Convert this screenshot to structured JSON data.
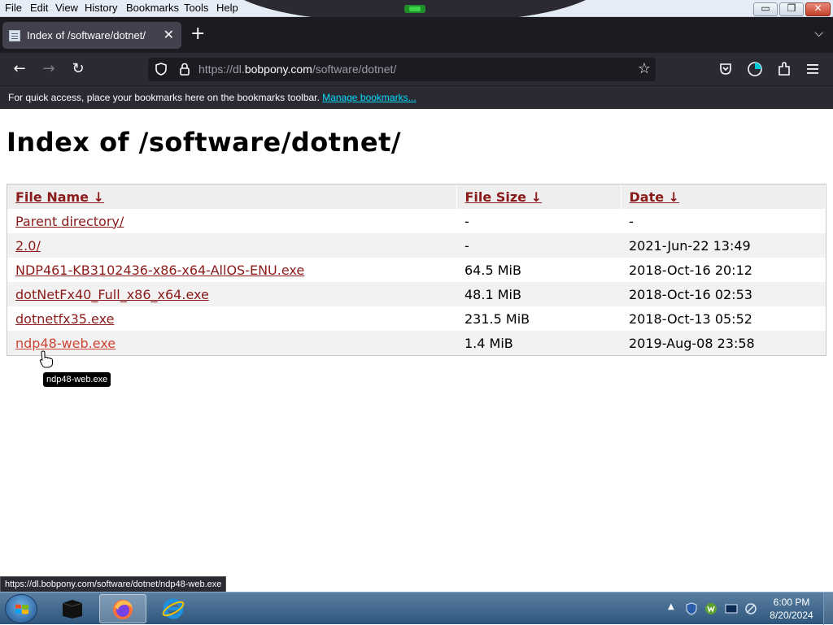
{
  "menubar": {
    "items": [
      "File",
      "Edit",
      "View",
      "History",
      "Bookmarks",
      "Tools",
      "Help"
    ],
    "window_buttons": {
      "minimize": "▭",
      "restore": "❐",
      "close": "✕"
    }
  },
  "tab": {
    "title": "Index of /software/dotnet/",
    "close_icon": "✕",
    "new_tab_icon": "+",
    "list_tabs_icon": "⌵"
  },
  "navbar": {
    "back_icon": "←",
    "forward_icon": "→",
    "reload_icon": "↻",
    "url_prefix": "https://dl.",
    "url_host": "bobpony.com",
    "url_path": "/software/dotnet/",
    "bookmark_star_icon": "☆"
  },
  "bookmarks_bar": {
    "message": "For quick access, place your bookmarks here on the bookmarks toolbar.",
    "manage_link": "Manage bookmarks..."
  },
  "page": {
    "title": "Index of /software/dotnet/",
    "columns": [
      "File Name  ↓",
      "File Size  ↓",
      "Date  ↓"
    ],
    "rows": [
      {
        "name": "Parent directory/",
        "size": "-",
        "date": "-"
      },
      {
        "name": "2.0/",
        "size": "-",
        "date": "2021-Jun-22 13:49"
      },
      {
        "name": "NDP461-KB3102436-x86-x64-AllOS-ENU.exe",
        "size": "64.5 MiB",
        "date": "2018-Oct-16 20:12"
      },
      {
        "name": "dotNetFx40_Full_x86_x64.exe",
        "size": "48.1 MiB",
        "date": "2018-Oct-16 02:53"
      },
      {
        "name": "dotnetfx35.exe",
        "size": "231.5 MiB",
        "date": "2018-Oct-13 05:52"
      },
      {
        "name": "ndp48-web.exe",
        "size": "1.4 MiB",
        "date": "2019-Aug-08 23:58"
      }
    ],
    "tooltip": "ndp48-web.exe",
    "status_link": "https://dl.bobpony.com/software/dotnet/ndp48-web.exe"
  },
  "taskbar": {
    "clock_time": "6:00 PM",
    "clock_date": "8/20/2024",
    "tray_expand_icon": "▲"
  }
}
